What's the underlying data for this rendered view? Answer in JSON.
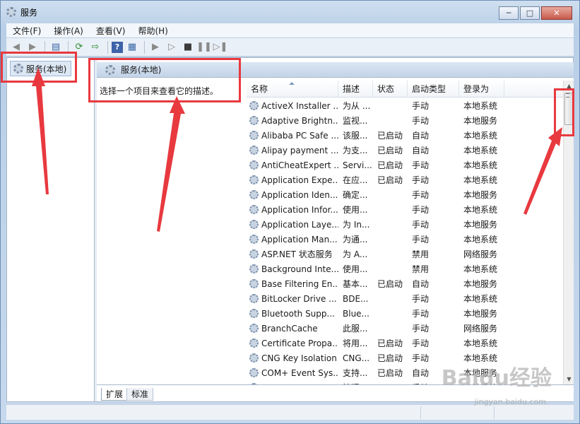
{
  "window": {
    "title": "服务"
  },
  "menu": [
    "文件(F)",
    "操作(A)",
    "查看(V)",
    "帮助(H)"
  ],
  "tree": {
    "root": "服务(本地)"
  },
  "pane": {
    "title": "服务(本地)",
    "description": "选择一个项目来查看它的描述。"
  },
  "columns": [
    "名称",
    "描述",
    "状态",
    "启动类型",
    "登录为"
  ],
  "services": [
    [
      "ActiveX Installer ...",
      "为从 ...",
      "",
      "手动",
      "本地系统"
    ],
    [
      "Adaptive Brightn...",
      "监视...",
      "",
      "手动",
      "本地服务"
    ],
    [
      "Alibaba PC Safe ...",
      "该服...",
      "已启动",
      "自动",
      "本地系统"
    ],
    [
      "Alipay payment ...",
      "为支...",
      "已启动",
      "自动",
      "本地系统"
    ],
    [
      "AntiCheatExpert ...",
      "Servi...",
      "已启动",
      "手动",
      "本地系统"
    ],
    [
      "Application Expe...",
      "在应...",
      "已启动",
      "手动",
      "本地系统"
    ],
    [
      "Application Iden...",
      "确定...",
      "",
      "手动",
      "本地服务"
    ],
    [
      "Application Infor...",
      "使用...",
      "",
      "手动",
      "本地系统"
    ],
    [
      "Application Laye...",
      "为 In...",
      "",
      "手动",
      "本地服务"
    ],
    [
      "Application Man...",
      "为通...",
      "",
      "手动",
      "本地系统"
    ],
    [
      "ASP.NET 状态服务",
      "为 A...",
      "",
      "禁用",
      "网络服务"
    ],
    [
      "Background Inte...",
      "使用...",
      "",
      "禁用",
      "本地系统"
    ],
    [
      "Base Filtering En...",
      "基本...",
      "已启动",
      "自动",
      "本地服务"
    ],
    [
      "BitLocker Drive ...",
      "BDE...",
      "",
      "手动",
      "本地系统"
    ],
    [
      "Bluetooth Supp...",
      "Blue...",
      "",
      "手动",
      "本地服务"
    ],
    [
      "BranchCache",
      "此服...",
      "",
      "手动",
      "网络服务"
    ],
    [
      "Certificate Propa...",
      "将用...",
      "已启动",
      "手动",
      "本地系统"
    ],
    [
      "CNG Key Isolation",
      "CNG...",
      "已启动",
      "手动",
      "本地系统"
    ],
    [
      "COM+ Event Sys...",
      "支持...",
      "已启动",
      "自动",
      "本地服务"
    ],
    [
      "COM+ System A...",
      "管理...",
      "",
      "手动",
      "本地系统"
    ]
  ],
  "tabs": [
    "扩展",
    "标准"
  ],
  "watermark": {
    "logo": "Baidu经验",
    "url": "jingyan.baidu.com"
  },
  "colors": {
    "annotation": "#e8393f",
    "header_blue": "#c3d4e8"
  }
}
